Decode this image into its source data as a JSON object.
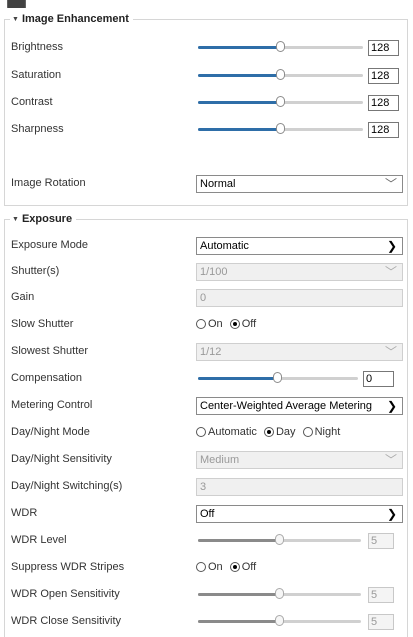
{
  "image_enhancement": {
    "title": "Image Enhancement",
    "brightness": {
      "label": "Brightness",
      "value": "128",
      "level": 0.5
    },
    "saturation": {
      "label": "Saturation",
      "value": "128",
      "level": 0.5
    },
    "contrast": {
      "label": "Contrast",
      "value": "128",
      "level": 0.5
    },
    "sharpness": {
      "label": "Sharpness",
      "value": "128",
      "level": 0.5
    },
    "image_rotation": {
      "label": "Image Rotation",
      "value": "Normal"
    }
  },
  "exposure": {
    "title": "Exposure",
    "exposure_mode": {
      "label": "Exposure Mode",
      "value": "Automatic"
    },
    "shutter": {
      "label": "Shutter(s)",
      "value": "1/100"
    },
    "gain": {
      "label": "Gain",
      "value": "0"
    },
    "slow_shutter": {
      "label": "Slow Shutter",
      "options": [
        "On",
        "Off"
      ],
      "selected": "Off"
    },
    "slowest_shutter": {
      "label": "Slowest Shutter",
      "value": "1/12"
    },
    "compensation": {
      "label": "Compensation",
      "value": "0",
      "level": 0.5
    },
    "metering_control": {
      "label": "Metering Control",
      "value": "Center-Weighted Average Metering"
    },
    "day_night_mode": {
      "label": "Day/Night Mode",
      "options": [
        "Automatic",
        "Day",
        "Night"
      ],
      "selected": "Day"
    },
    "day_night_sensitivity": {
      "label": "Day/Night Sensitivity",
      "value": "Medium"
    },
    "day_night_switching": {
      "label": "Day/Night Switching(s)",
      "value": "3"
    },
    "wdr": {
      "label": "WDR",
      "value": "Off"
    },
    "wdr_level": {
      "label": "WDR Level",
      "value": "5",
      "level": 0.5
    },
    "suppress_wdr_stripes": {
      "label": "Suppress WDR Stripes",
      "options": [
        "On",
        "Off"
      ],
      "selected": "Off"
    },
    "wdr_open_sensitivity": {
      "label": "WDR Open Sensitivity",
      "value": "5",
      "level": 0.5
    },
    "wdr_close_sensitivity": {
      "label": "WDR Close Sensitivity",
      "value": "5",
      "level": 0.5
    }
  },
  "colors": {
    "accent": "#2e6ea8",
    "disabled_fill": "#8a8a8a",
    "heading_fragment": "#2a8fd6"
  },
  "icons": {
    "collapse": "triangle-down-icon",
    "dropdown": "chevron-down-icon"
  }
}
